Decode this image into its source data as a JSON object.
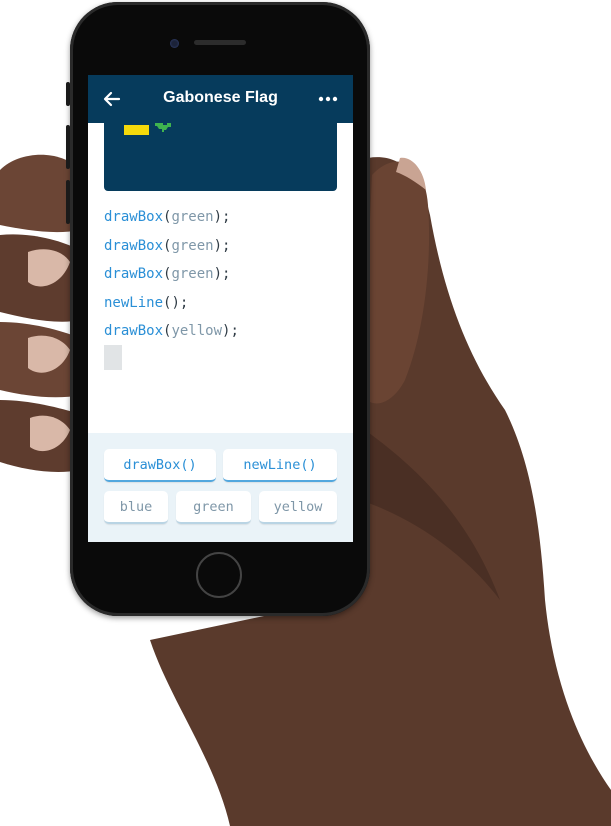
{
  "app": {
    "title": "Gabonese Flag",
    "back_icon": "arrow-left-icon",
    "menu_icon": "more-horizontal-icon"
  },
  "code_lines": [
    {
      "fn": "drawBox",
      "open": "(",
      "arg": "green",
      "close": ");"
    },
    {
      "fn": "drawBox",
      "open": "(",
      "arg": "green",
      "close": ");"
    },
    {
      "fn": "drawBox",
      "open": "(",
      "arg": "green",
      "close": ");"
    },
    {
      "fn": "newLine",
      "open": "(",
      "arg": "",
      "close": ");"
    },
    {
      "fn": "drawBox",
      "open": "(",
      "arg": "yellow",
      "close": ");"
    }
  ],
  "suggestions": {
    "functions": [
      "drawBox()",
      "newLine()"
    ],
    "values": [
      "blue",
      "green",
      "yellow"
    ]
  },
  "colors": {
    "app_bar": "#063b5c",
    "function_text": "#2a8fd6",
    "argument_text": "#7f97a8",
    "flag_yellow": "#f5d90b",
    "flag_green": "#3fb34f",
    "tray_background": "#eaf3f8"
  }
}
